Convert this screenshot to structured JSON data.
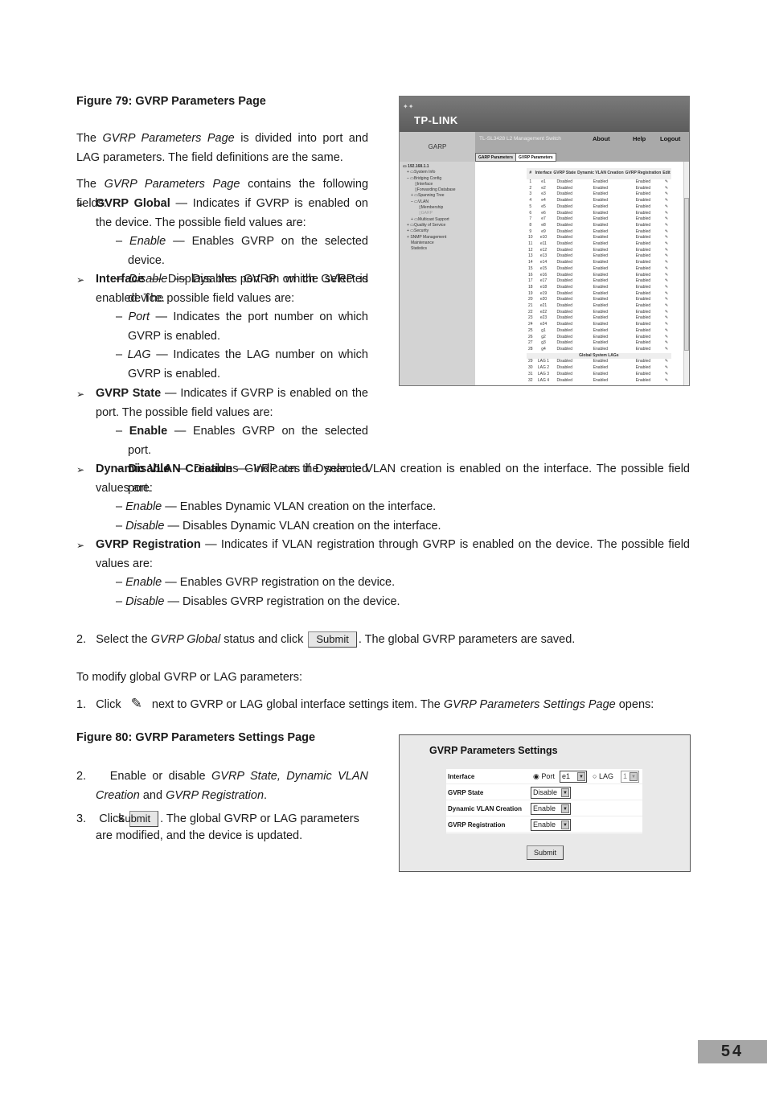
{
  "fig79_caption": "Figure 79: GVRP Parameters Page",
  "para1": {
    "a": "The ",
    "i": "GVRP Parameters Page",
    "b": " is divided into port and LAG parameters. The field definitions are the same."
  },
  "para2": {
    "a": "The ",
    "i": "GVRP Parameters Page",
    "b": " contains the following fields:"
  },
  "bullet_glyph": "➢",
  "fields": {
    "gvrp_global": {
      "term": "GVRP Global",
      "desc": " — Indicates if GVRP is enabled on the device. The possible field values are:",
      "opts": [
        {
          "t": "Enable",
          "d": " — Enables GVRP on the selected device."
        },
        {
          "t": "Disable",
          "d": " — Disables GVRP on the selected device."
        }
      ]
    },
    "interface": {
      "term": "Interface",
      "desc": " — Displays the port on which GVRP is enabled. The possible field values are:",
      "opts": [
        {
          "t": "Port",
          "d": " — Indicates the port number on which GVRP is enabled."
        },
        {
          "t": "LAG",
          "d": " — Indicates the LAG number on which GVRP is enabled."
        }
      ]
    },
    "gvrp_state": {
      "term": "GVRP State",
      "desc": " — Indicates if GVRP is enabled on the port. The possible field values are:",
      "opts": [
        {
          "t": "Enable",
          "d": " — Enables GVRP on the selected port."
        },
        {
          "t": "Disable",
          "d": " — Disables GVRP on the selected port."
        }
      ]
    },
    "dynamic_vlan": {
      "term": "Dynamic VLAN Creation",
      "desc": " — Indicates if Dynamic VLAN creation is enabled on the interface. The possible field values are:",
      "opts": [
        {
          "t": "Enable",
          "d": " — Enables Dynamic VLAN creation on the interface."
        },
        {
          "t": "Disable",
          "d": " — Disables Dynamic VLAN creation on the interface."
        }
      ]
    },
    "gvrp_registration": {
      "term": "GVRP Registration",
      "desc": " — Indicates if VLAN registration through GVRP is enabled on the device. The possible field values are:",
      "opts": [
        {
          "t": "Enable",
          "d": " — Enables GVRP registration on the device."
        },
        {
          "t": "Disable",
          "d": " — Disables GVRP registration on the device."
        }
      ]
    }
  },
  "step2": {
    "n": "2.",
    "a": "Select the ",
    "i": "GVRP Global",
    "b": " status and click ",
    "btn": "Submit",
    "c": ". The global GVRP parameters are saved."
  },
  "modify_intro": "To modify global GVRP or LAG parameters:",
  "step1b": {
    "n": "1.",
    "a": "Click ",
    "b": " next to GVRP or LAG global interface settings item. The ",
    "i": "GVRP Parameters Settings Page",
    "c": " opens:"
  },
  "fig80_caption": "Figure 80: GVRP Parameters Settings Page",
  "step2b": {
    "n": "2.",
    "a": "Enable or disable ",
    "i1": "GVRP State, Dynamic VLAN Creation",
    "b": " and ",
    "i2": "GVRP Registration",
    "c": "."
  },
  "step3b": {
    "n": "3.",
    "a": "Click ",
    "btn": "Submit",
    "b": ". The global GVRP or LAG parameters are modified, and the device is updated."
  },
  "fig79": {
    "logo": "TP-LINK",
    "section": "GARP",
    "title": "TL-SL3428 L2 Management Switch",
    "links": [
      "About",
      "Help",
      "Logout"
    ],
    "tabs": [
      "GARP Parameters",
      "GVRP Parameters"
    ],
    "active_tab": "GVRP Parameters",
    "tree": [
      "192.168.1.1",
      "System Info",
      "Bridging Config",
      "Interface",
      "Forwarding Database",
      "Spanning Tree",
      "VLAN",
      "Membership",
      "GARP",
      "Multicast Support",
      "Quality of Service",
      "Security",
      "SNMP Management",
      "Maintenance",
      "Statistics"
    ],
    "headers": [
      "#",
      "Interface",
      "GVRP State",
      "Dynamic VLAN Creation",
      "GVRP Registration",
      "Edit"
    ],
    "rows": [
      [
        "1",
        "e1",
        "Disabled",
        "Enabled",
        "Enabled"
      ],
      [
        "2",
        "e2",
        "Disabled",
        "Enabled",
        "Enabled"
      ],
      [
        "3",
        "e3",
        "Disabled",
        "Enabled",
        "Enabled"
      ],
      [
        "4",
        "e4",
        "Disabled",
        "Enabled",
        "Enabled"
      ],
      [
        "5",
        "e5",
        "Disabled",
        "Enabled",
        "Enabled"
      ],
      [
        "6",
        "e6",
        "Disabled",
        "Enabled",
        "Enabled"
      ],
      [
        "7",
        "e7",
        "Disabled",
        "Enabled",
        "Enabled"
      ],
      [
        "8",
        "e8",
        "Disabled",
        "Enabled",
        "Enabled"
      ],
      [
        "9",
        "e9",
        "Disabled",
        "Enabled",
        "Enabled"
      ],
      [
        "10",
        "e10",
        "Disabled",
        "Enabled",
        "Enabled"
      ],
      [
        "11",
        "e11",
        "Disabled",
        "Enabled",
        "Enabled"
      ],
      [
        "12",
        "e12",
        "Disabled",
        "Enabled",
        "Enabled"
      ],
      [
        "13",
        "e13",
        "Disabled",
        "Enabled",
        "Enabled"
      ],
      [
        "14",
        "e14",
        "Disabled",
        "Enabled",
        "Enabled"
      ],
      [
        "15",
        "e15",
        "Disabled",
        "Enabled",
        "Enabled"
      ],
      [
        "16",
        "e16",
        "Disabled",
        "Enabled",
        "Enabled"
      ],
      [
        "17",
        "e17",
        "Disabled",
        "Enabled",
        "Enabled"
      ],
      [
        "18",
        "e18",
        "Disabled",
        "Enabled",
        "Enabled"
      ],
      [
        "19",
        "e19",
        "Disabled",
        "Enabled",
        "Enabled"
      ],
      [
        "20",
        "e20",
        "Disabled",
        "Enabled",
        "Enabled"
      ],
      [
        "21",
        "e21",
        "Disabled",
        "Enabled",
        "Enabled"
      ],
      [
        "22",
        "e22",
        "Disabled",
        "Enabled",
        "Enabled"
      ],
      [
        "23",
        "e23",
        "Disabled",
        "Enabled",
        "Enabled"
      ],
      [
        "24",
        "e24",
        "Disabled",
        "Enabled",
        "Enabled"
      ],
      [
        "25",
        "g1",
        "Disabled",
        "Enabled",
        "Enabled"
      ],
      [
        "26",
        "g2",
        "Disabled",
        "Enabled",
        "Enabled"
      ],
      [
        "27",
        "g3",
        "Disabled",
        "Enabled",
        "Enabled"
      ],
      [
        "28",
        "g4",
        "Disabled",
        "Enabled",
        "Enabled"
      ]
    ],
    "lag_header": "Global System LAGs",
    "lag_rows": [
      [
        "29",
        "LAG 1",
        "Disabled",
        "Enabled",
        "Enabled"
      ],
      [
        "30",
        "LAG 2",
        "Disabled",
        "Enabled",
        "Enabled"
      ],
      [
        "31",
        "LAG 3",
        "Disabled",
        "Enabled",
        "Enabled"
      ],
      [
        "32",
        "LAG 4",
        "Disabled",
        "Enabled",
        "Enabled"
      ]
    ]
  },
  "fig80": {
    "title": "GVRP Parameters Settings",
    "interface_label": "Interface",
    "port_label": "Port",
    "port_value": "e1",
    "lag_label": "LAG",
    "lag_value": "1",
    "selected_radio": "Port",
    "gvrp_state_label": "GVRP State",
    "gvrp_state_value": "Disable",
    "dynamic_label": "Dynamic VLAN Creation",
    "dynamic_value": "Enable",
    "registration_label": "GVRP Registration",
    "registration_value": "Enable",
    "submit": "Submit"
  },
  "page_number": "54"
}
